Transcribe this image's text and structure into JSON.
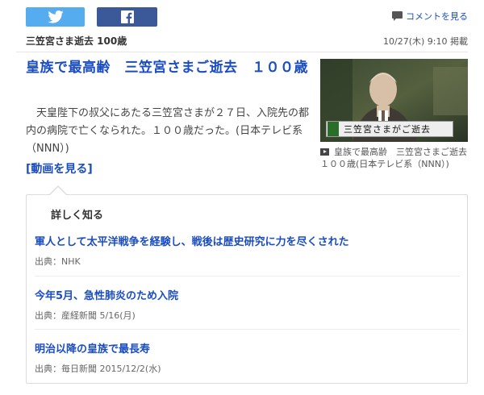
{
  "share": {
    "twitter_icon": "twitter-bird-icon",
    "facebook_icon": "facebook-f-icon",
    "twitter_color": "#55acee",
    "facebook_color": "#3b5998"
  },
  "comment": {
    "label": "コメントを見る",
    "icon": "comment-bubble-icon"
  },
  "header": {
    "title": "三笠宮さま逝去 100歳",
    "date": "10/27(木) 9:10 掲載"
  },
  "article": {
    "title": "皇族で最高齢　三笠宮さまご逝去　１００歳",
    "body": "天皇陛下の叔父にあたる三笠宮さまが２７日、入院先の都内の病院で亡くなられた。１００歳だった。(日本テレビ系（NNN）)",
    "video_link": "[動画を見る]"
  },
  "thumbnail": {
    "caption": "三笠宮さまがご逝去",
    "text": "皇族で最高齢　三笠宮さまご逝去　１００歳(日本テレビ系（NNN）)"
  },
  "details": {
    "heading": "詳しく知る",
    "items": [
      {
        "title": "軍人として太平洋戦争を経験し、戦後は歴史研究に力を尽くされた",
        "source": "出典：NHK"
      },
      {
        "title": "今年5月、急性肺炎のため入院",
        "source": "出典：産経新聞 5/16(月)"
      },
      {
        "title": "明治以降の皇族で最長寿",
        "source": "出典：毎日新聞 2015/12/2(水)"
      }
    ]
  },
  "colors": {
    "link": "#1a4cc2",
    "text": "#333333"
  }
}
